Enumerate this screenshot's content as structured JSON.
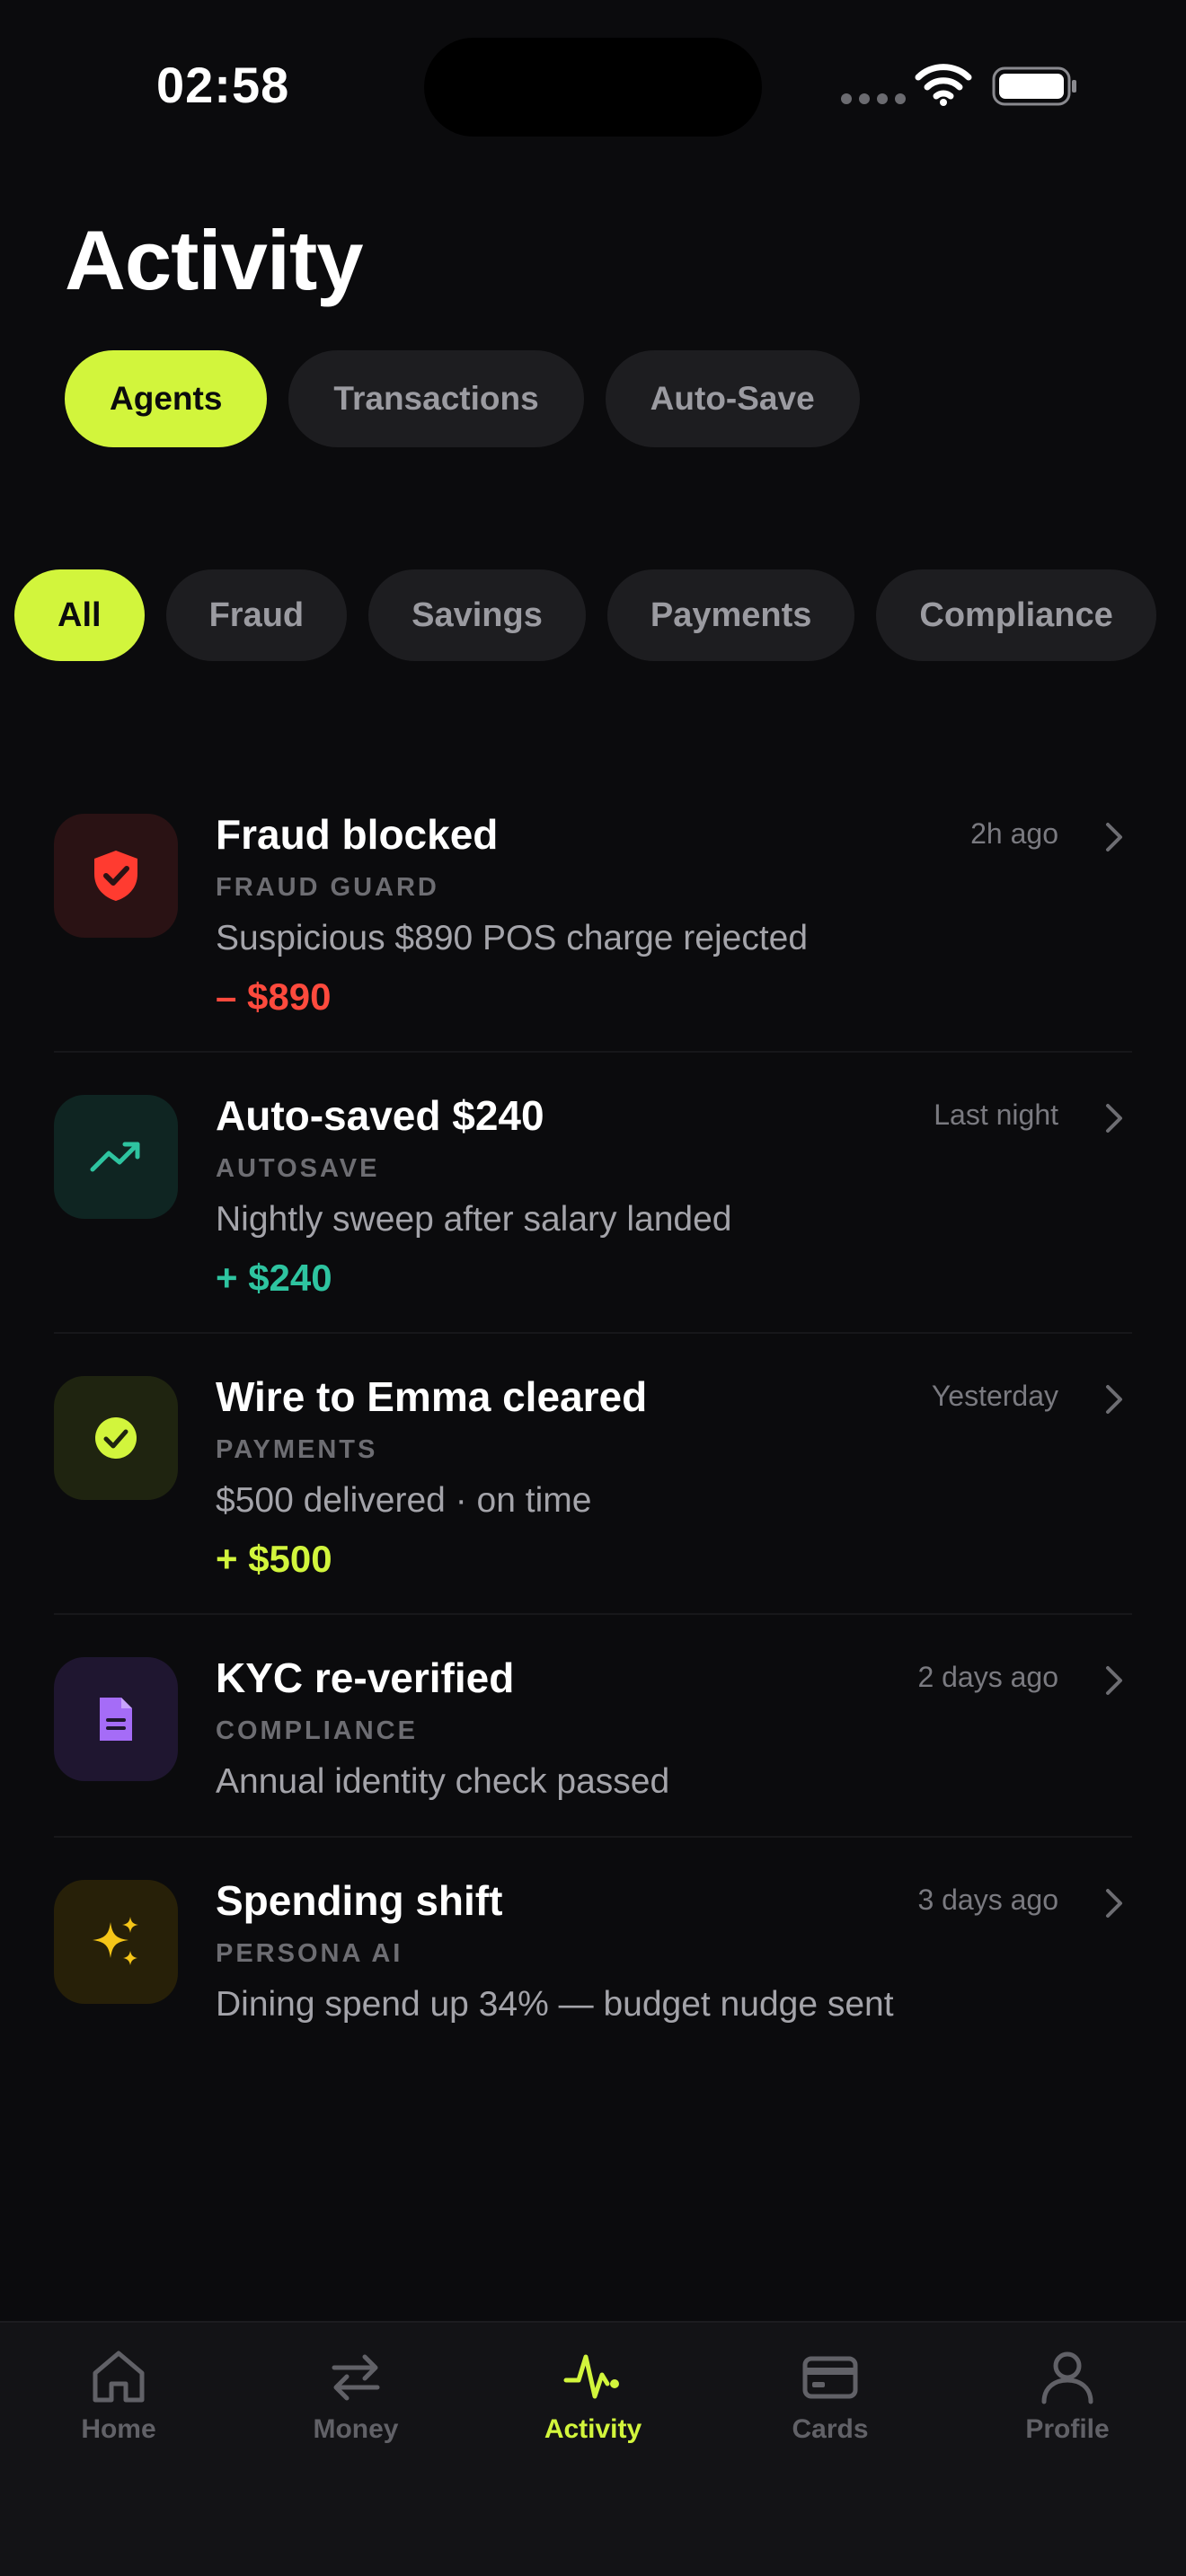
{
  "status_bar": {
    "time": "02:58"
  },
  "page": {
    "title": "Activity"
  },
  "tabs": [
    {
      "label": "Agents",
      "active": true
    },
    {
      "label": "Transactions",
      "active": false
    },
    {
      "label": "Auto-Save",
      "active": false
    }
  ],
  "filters": [
    {
      "label": "All",
      "active": true
    },
    {
      "label": "Fraud",
      "active": false
    },
    {
      "label": "Savings",
      "active": false
    },
    {
      "label": "Payments",
      "active": false
    },
    {
      "label": "Compliance",
      "active": false
    }
  ],
  "feed": [
    {
      "title": "Fraud blocked",
      "category": "FRAUD GUARD",
      "description": "Suspicious $890 POS charge rejected",
      "amount": "– $890",
      "amount_color": "#ff4a3d",
      "time": "2h ago",
      "icon": "shield-check-icon",
      "icon_bg": "#2a1214",
      "icon_color": "#ff3b30"
    },
    {
      "title": "Auto-saved $240",
      "category": "AUTOSAVE",
      "description": "Nightly sweep after salary landed",
      "amount": "+ $240",
      "amount_color": "#2ec4a0",
      "time": "Last night",
      "icon": "trend-up-icon",
      "icon_bg": "#0f2522",
      "icon_color": "#2ec4a0"
    },
    {
      "title": "Wire to Emma cleared",
      "category": "PAYMENTS",
      "description": "$500 delivered · on time",
      "amount": "+ $500",
      "amount_color": "#d2f53c",
      "time": "Yesterday",
      "icon": "check-circle-icon",
      "icon_bg": "#1f2410",
      "icon_color": "#d2f53c"
    },
    {
      "title": "KYC re-verified",
      "category": "COMPLIANCE",
      "description": "Annual identity check passed",
      "amount": "",
      "amount_color": "",
      "time": "2 days ago",
      "icon": "document-icon",
      "icon_bg": "#1f1630",
      "icon_color": "#a56cf7"
    },
    {
      "title": "Spending shift",
      "category": "PERSONA AI",
      "description": "Dining spend up 34% — budget nudge sent",
      "amount": "",
      "amount_color": "",
      "time": "3 days ago",
      "icon": "sparkles-icon",
      "icon_bg": "#272008",
      "icon_color": "#f5c518"
    }
  ],
  "tabbar": [
    {
      "label": "Home",
      "icon": "home-icon",
      "active": false
    },
    {
      "label": "Money",
      "icon": "transfer-arrows-icon",
      "active": false
    },
    {
      "label": "Activity",
      "icon": "pulse-icon",
      "active": true
    },
    {
      "label": "Cards",
      "icon": "card-icon",
      "active": false
    },
    {
      "label": "Profile",
      "icon": "person-icon",
      "active": false
    }
  ],
  "colors": {
    "accent": "#d2f53c",
    "background": "#0b0b0d",
    "surface": "#1d1d20"
  }
}
